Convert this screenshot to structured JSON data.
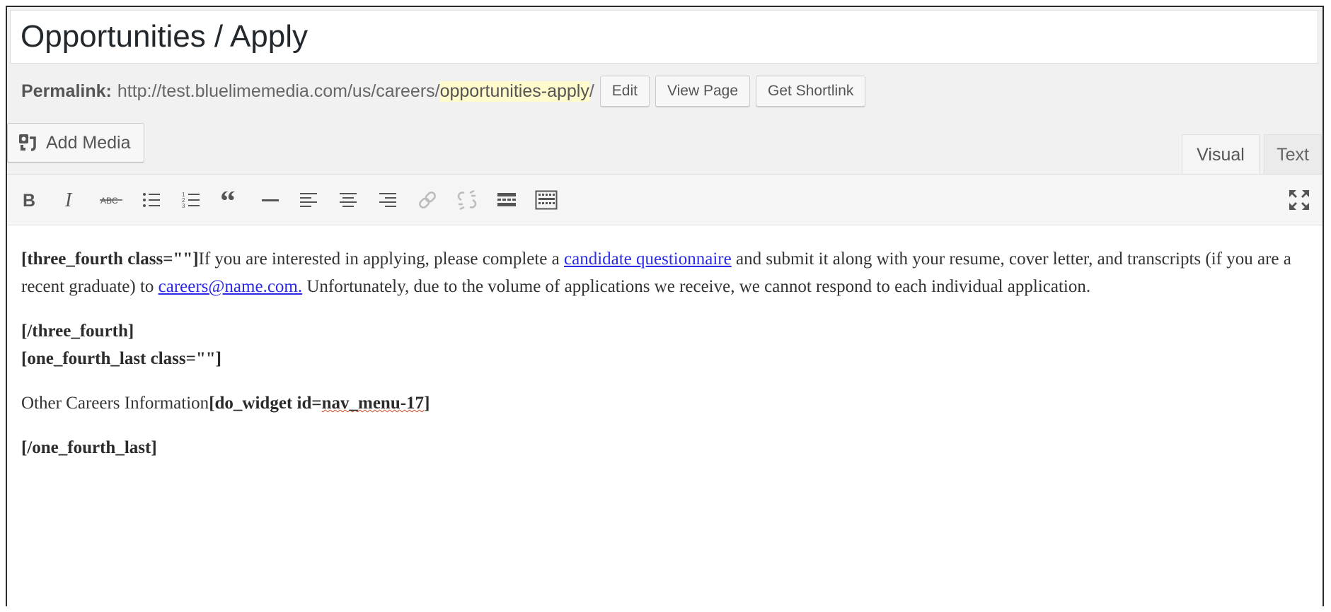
{
  "title": "Opportunities / Apply",
  "permalink": {
    "label": "Permalink:",
    "base_url": "http://test.bluelimemedia.com/us/careers/",
    "slug": "opportunities-apply",
    "trailing": "/",
    "buttons": {
      "edit": "Edit",
      "view_page": "View Page",
      "get_shortlink": "Get Shortlink"
    }
  },
  "media": {
    "add_media_label": "Add Media"
  },
  "tabs": {
    "visual": "Visual",
    "text": "Text"
  },
  "toolbar": {
    "icons": [
      "bold-icon",
      "italic-icon",
      "strikethrough-icon",
      "bullet-list-icon",
      "numbered-list-icon",
      "blockquote-icon",
      "horizontal-line-icon",
      "align-left-icon",
      "align-center-icon",
      "align-right-icon",
      "insert-link-icon",
      "remove-link-icon",
      "read-more-icon",
      "toolbar-toggle-icon",
      "fullscreen-icon"
    ]
  },
  "content": {
    "p1": {
      "shortcode_open": "[three_fourth class=\"\"]",
      "text_a": "If you are interested in applying, please complete a ",
      "link1": "candidate questionnaire",
      "text_b": " and submit it along with your resume, cover letter, and transcripts (if you are a recent graduate) to ",
      "link2": "careers@name.com.",
      "text_c": " Unfortunately, due to the volume of applications we receive, we cannot respond to each individual application."
    },
    "p2": {
      "line1": "[/three_fourth]",
      "line2": "[one_fourth_last class=\"\"]"
    },
    "p3": {
      "text": "Other Careers Information",
      "code_a": "[do_widget id=",
      "code_misspelled": "nav_menu-17",
      "code_b": "]"
    },
    "p4": {
      "line": "[/one_fourth_last]"
    }
  },
  "colors": {
    "slug_highlight": "#fffbcc",
    "link": "#2929e6",
    "spellcheck_underline": "#d54e21"
  }
}
